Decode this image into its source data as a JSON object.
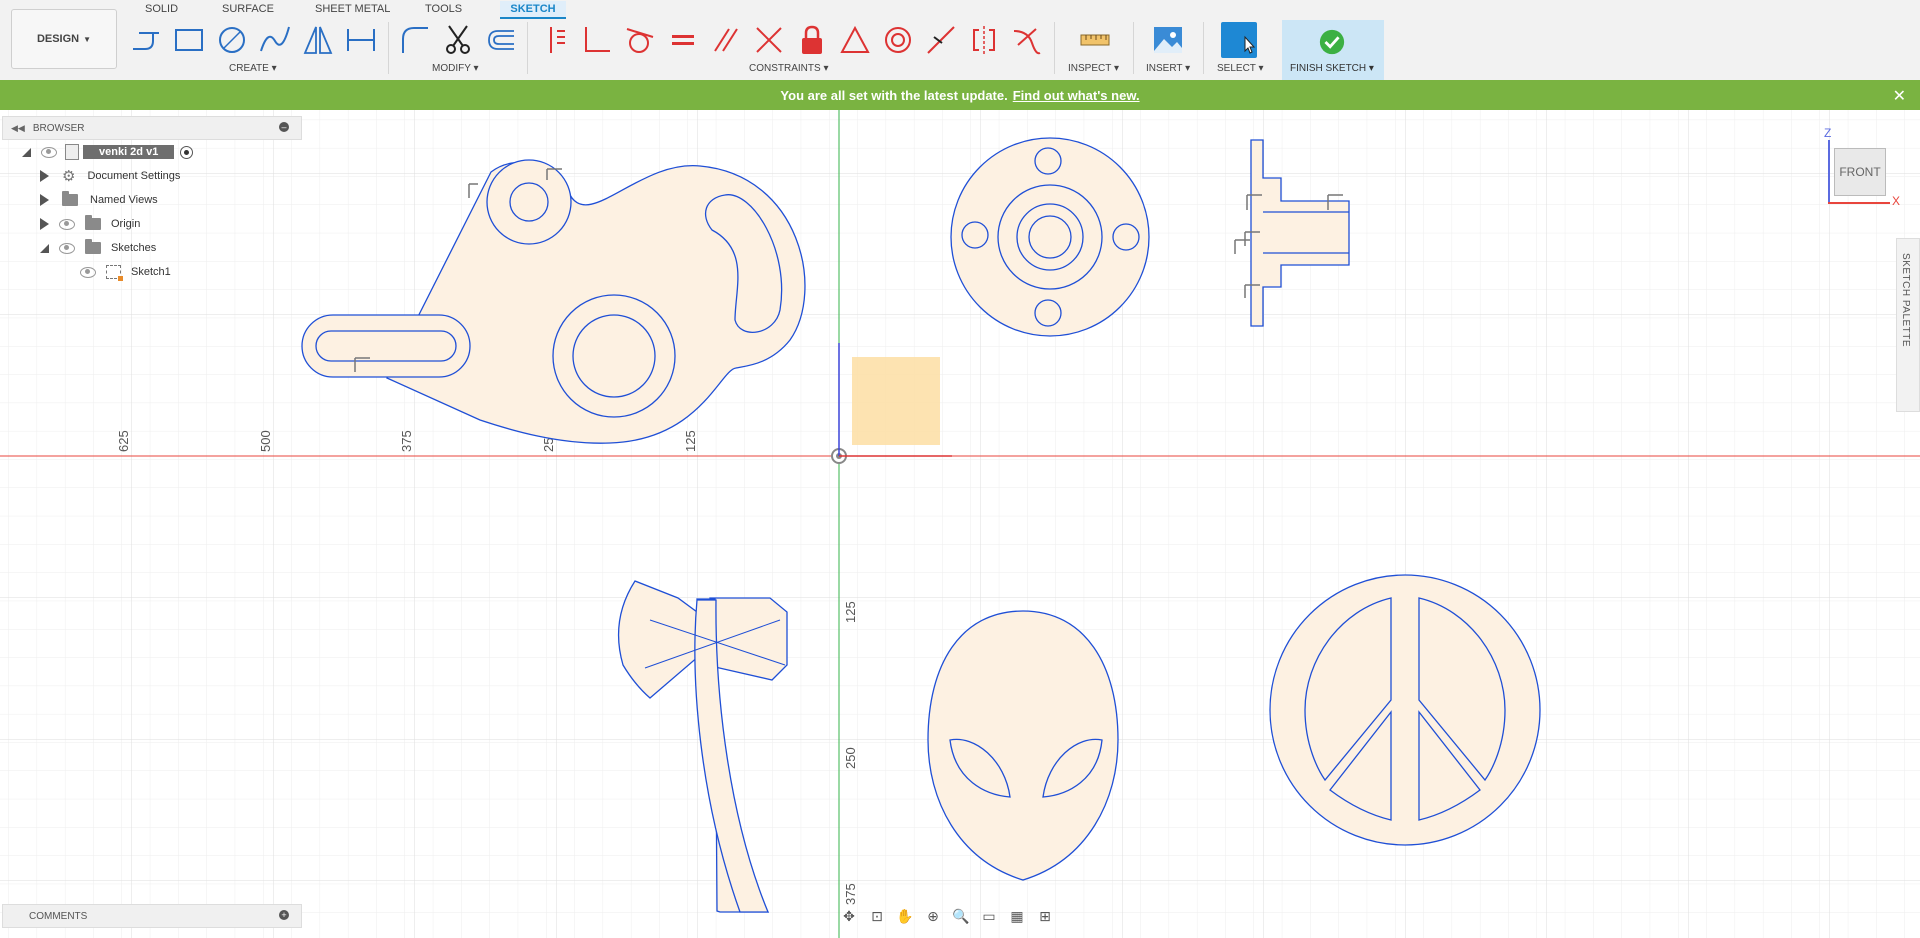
{
  "workspace": {
    "label": "DESIGN"
  },
  "tabs": [
    {
      "label": "SOLID",
      "active": false
    },
    {
      "label": "SURFACE",
      "active": false
    },
    {
      "label": "SHEET METAL",
      "active": false
    },
    {
      "label": "TOOLS",
      "active": false
    },
    {
      "label": "SKETCH",
      "active": true
    }
  ],
  "groups": {
    "create": "CREATE",
    "modify": "MODIFY",
    "constraints": "CONSTRAINTS",
    "inspect": "INSPECT",
    "insert": "INSERT",
    "select": "SELECT",
    "finish": "FINISH SKETCH"
  },
  "banner": {
    "text": "You are all set with the latest update.",
    "link": "Find out what's new.",
    "close": "✕"
  },
  "browser": {
    "title": "BROWSER",
    "root": "venki 2d v1",
    "items": [
      "Document Settings",
      "Named Views",
      "Origin",
      "Sketches",
      "Sketch1"
    ]
  },
  "comments": {
    "title": "COMMENTS"
  },
  "palette": {
    "label": "SKETCH PALETTE"
  },
  "viewcube": {
    "face": "FRONT",
    "axis_z": "Z",
    "axis_x": "X"
  },
  "axis_labels": {
    "horizontal": [
      "625",
      "500",
      "375",
      "250",
      "125"
    ],
    "vertical": [
      "125",
      "250",
      "375"
    ]
  },
  "colors": {
    "accent": "#1a86c8",
    "banner": "#7ab341",
    "sketch_line": "#1f4fd6",
    "profile_fill": "#fdf1e2",
    "x_axis": "#e8453c",
    "y_axis": "#36b34a"
  }
}
